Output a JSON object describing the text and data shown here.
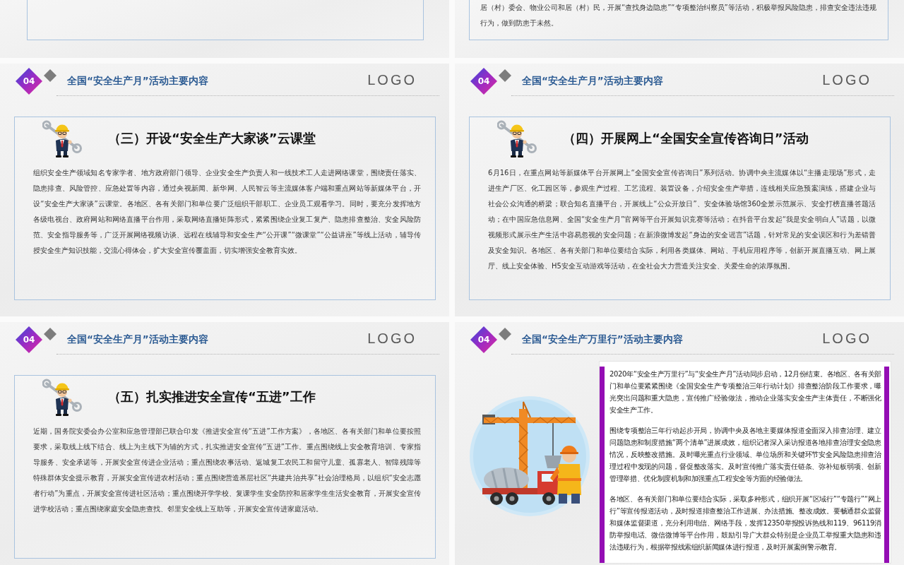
{
  "top_slides": [
    {
      "kind": "blank"
    },
    {
      "kind": "text",
      "paragraph": "居（村）委会、物业公司和居（村）民，开展“查找身边隐患”“专项整治纠察员”等活动，积极举报风险隐患，排查安全违法违规行为，做到防患于未然。"
    }
  ],
  "slides": [
    {
      "kind": "article",
      "badge": "04",
      "title": "全国“安全生产月”活动主要内容",
      "logo": "LOGO",
      "heading": "（三）开设“安全生产大家谈”云课堂",
      "paragraph": "组织安全生产领域知名专家学者、地方政府部门领导、企业安全生产负责人和一线技术工人走进网络课堂，围绕责任落实、隐患排查、风险管控、应急处置等内容，通过央视新闻、新华网、人民智云等主流媒体客户端和重点网站等新媒体平台，开设“安全生产大家谈”云课堂。各地区、各有关部门和单位要广泛组织干部职工、企业员工观看学习。同时，要充分发挥地方各级电视台、政府网站和网络直播平台作用，采取网络直播矩阵形式，紧紧围绕企业复工复产、隐患排查整治、安全风险防范、安全指导服务等，广泛开展网络视频访谈、远程在线辅导和安全生产“公开课”“微课堂”“公益讲座”等线上活动，辅导传授安全生产知识技能，交流心得体会，扩大安全宣传覆盖面，切实增强安全教育实效。"
    },
    {
      "kind": "article",
      "badge": "04",
      "title": "全国“安全生产月”活动主要内容",
      "logo": "LOGO",
      "heading": "（四）开展网上“全国安全宣传咨询日”活动",
      "paragraph": "6月16日，在重点网站等新媒体平台开展网上“全国安全宣传咨询日”系列活动。协调中央主流媒体以“主播走现场”形式，走进生产厂区、化工园区等，参观生产过程、工艺流程、装置设备，介绍安全生产举措，连线相关应急预案演练，搭建企业与社会公众沟通的桥梁；联合知名直播平台，开展线上“公众开放日”、安全体验场馆360全景示范展示、安全打榜直播答题活动；在中国应急信息网、全国“安全生产月”官网等平台开展知识竞赛等活动；在抖音平台发起“我是安全明白人”话题，以微视频形式展示生产生活中容易忽视的安全问题；在新浪微博发起“身边的安全谣言”话题，针对常见的安全误区和行为差错普及安全知识。各地区、各有关部门和单位要结合实际，利用各类媒体、网站、手机应用程序等，创新开展直播互动、网上展厅、线上安全体验、H5安全互动游戏等活动，在全社会大力营造关注安全、关爱生命的浓厚氛围。"
    },
    {
      "kind": "article",
      "badge": "04",
      "title": "全国“安全生产月”活动主要内容",
      "logo": "LOGO",
      "heading": "（五）扎实推进安全宣传“五进”工作",
      "paragraph": "近期，国务院安委会办公室和应急管理部已联合印发《推进安全宣传“五进”工作方案》，各地区、各有关部门和单位要按照要求，采取线上线下结合、线上为主线下为辅的方式，扎实推进安全宣传“五进”工作。重点围绕线上安全教育培训、专家指导服务、安全承诺等，开展安全宣传进企业活动；重点围绕农事活动、返城复工农民工和留守儿童、孤寡老人、智障残障等特殊群体安全提示教育，开展安全宣传进农村活动；重点围绕营造基层社区“共建共治共享”社会治理格局，以组织“安全志愿者行动”为重点，开展安全宣传进社区活动；重点围绕开学学校、复课学生安全防控和居家学生生活安全教育，开展安全宣传进学校活动；重点围绕家庭安全隐患查找、邻里安全线上互助等，开展安全宣传进家庭活动。"
    },
    {
      "kind": "illustrated",
      "badge": "04",
      "title": "全国“安全生产万里行”活动主要内容",
      "logo": "LOGO",
      "paragraphs": [
        "2020年“安全生产万里行”与“安全生产月”活动同步启动，12月份结束。各地区、各有关部门和单位要紧紧围绕《全国安全生产专项整治三年行动计划》排查整治阶段工作要求，曝光突出问题和重大隐患，宣传推广经验做法，推动企业落实安全生产主体责任，不断强化安全生产工作。",
        "围绕专项整治三年行动起步开局，协调中央及各地主要媒体报道全面深入排查治理、建立问题隐患和制度措施“两个清单”进展成效，组织记者深入采访报道各地排查治理安全隐患情况，反映整改措施。及时曝光重点行业领域、单位场所和关键环节安全风险隐患排查治理过程中发现的问题，督促整改落实。及时宣传推广落实责任链条、弥补短板弱项、创新管理举措、优化制度机制和加强重点工程安全等方面的经验做法。",
        "各地区、各有关部门和单位要结合实际，采取多种形式，组织开展“区域行”“专题行”“网上行”等宣传报道活动，及时报道排查整治工作进展、办法措施、整改成效。要畅通群众监督和媒体监督渠道，充分利用电信、网络手段，发挥12350举报投诉热线和119、96119消防举报电话、微信微博等平台作用，鼓励引导广大群众特别是企业员工举报重大隐患和违法违规行为，根据举报线索组织新闻媒体进行报道，及时开展案例警示教育。"
      ]
    }
  ]
}
